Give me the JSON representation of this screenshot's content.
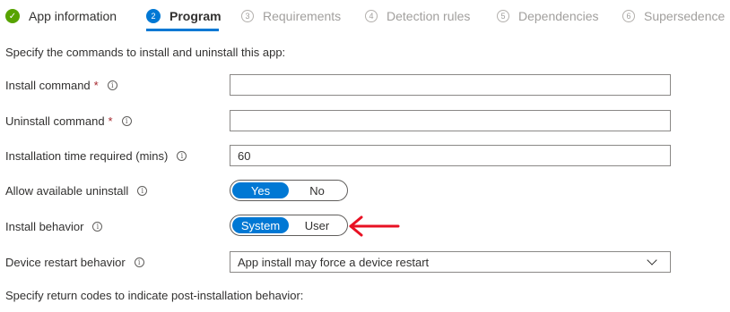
{
  "wizard": {
    "steps": [
      {
        "number": "✓",
        "label": "App information",
        "state": "done"
      },
      {
        "number": "2",
        "label": "Program",
        "state": "active"
      },
      {
        "number": "3",
        "label": "Requirements",
        "state": "todo"
      },
      {
        "number": "4",
        "label": "Detection rules",
        "state": "todo"
      },
      {
        "number": "5",
        "label": "Dependencies",
        "state": "todo"
      },
      {
        "number": "6",
        "label": "Supersedence",
        "state": "todo"
      }
    ]
  },
  "form": {
    "intro": "Specify the commands to install and uninstall this app:",
    "install_command": {
      "label": "Install command",
      "required": "*",
      "value": ""
    },
    "uninstall_command": {
      "label": "Uninstall command",
      "required": "*",
      "value": ""
    },
    "install_time": {
      "label": "Installation time required (mins)",
      "value": "60"
    },
    "allow_uninstall": {
      "label": "Allow available uninstall",
      "options": [
        "Yes",
        "No"
      ],
      "selected": "Yes"
    },
    "install_behavior": {
      "label": "Install behavior",
      "options": [
        "System",
        "User"
      ],
      "selected": "System"
    },
    "restart_behavior": {
      "label": "Device restart behavior",
      "value": "App install may force a device restart"
    },
    "outro": "Specify return codes to indicate post-installation behavior:"
  },
  "colors": {
    "accent": "#0078d4",
    "success": "#57a300",
    "required": "#a4262c",
    "annotation_arrow": "#e81123"
  },
  "icons": {
    "info": "info-icon",
    "check": "check-icon",
    "dropdown": "chevron-down-icon"
  }
}
